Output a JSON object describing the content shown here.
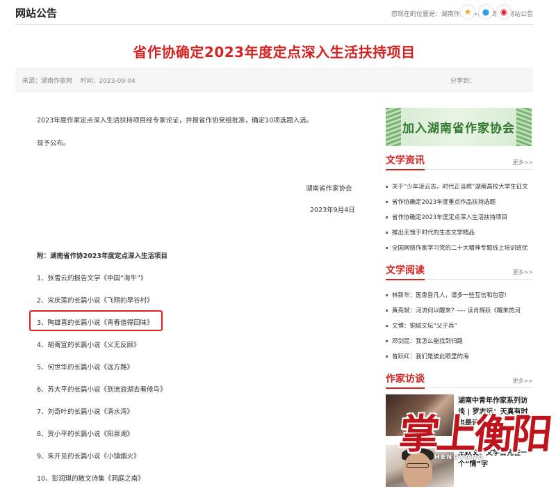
{
  "header": {
    "page_title": "网站公告",
    "breadcrumb": "您现在的位置是：湖南作家网>新闻资讯>网站公告"
  },
  "article": {
    "title": "省作协确定2023年度定点深入生活扶持项目",
    "meta": "来源：湖南作家网    时间：2023-09-04",
    "share_label": "分享到：",
    "share_icons": [
      "qzone-icon",
      "qq-icon",
      "weibo-icon"
    ],
    "paragraph_1": "2023年度作家定点深入生活扶持项目经专家论证，并报省作协党组批准，确定10项选题入选。",
    "paragraph_2": "现予公布。",
    "sign_org": "湖南省作家协会",
    "sign_date": "2023年9月4日",
    "annex_title": "附：湖南省作协2023年度定点深入生活项目",
    "items": [
      "1、张雪云的报告文学《中国“海牛”》",
      "2、宋庆莲的长篇小说《飞翔的早谷村》",
      "3、陶雄喜的长篇小说《青春值得回味》",
      "4、胡菁宣的长篇小说《义无反顾》",
      "5、何世华的长篇小说《远方路》",
      "6、苏大平的长篇小说《到流浪湖去看候鸟》",
      "7、刘奇叶的长篇小说《清水湾》",
      "8、贺小平的长篇小说《阳泉湖》",
      "9、朱开见的长篇小说《小镇烟火》",
      "10、彭润琪的散文诗集《洞庭之南》"
    ],
    "highlight_color": "#e02020"
  },
  "sidebar": {
    "banner_text": "加入湖南省作家协会",
    "more_label": "更多>>",
    "news": {
      "title": "文学资讯",
      "items": [
        "关于“少年凌云志，时代正当燃”湖南高校大学生征文",
        "省作协确定2023年度重点作品扶持选题",
        "省作协确定2023年度定点深入生活扶持项目",
        "推出无愧于时代的生态文学精品",
        "全国网络作家学习党的二十大精神专题线上培训班优"
      ]
    },
    "reading": {
      "title": "文学阅读",
      "items": [
        "林新华：医患皆凡人，请多一些互信和包容!",
        "黄亮斌：河流何以醒来？---- 读肖辉跃《醒来的河",
        "文博：铜城文坛“父子兵”",
        "邓剑昆：我怎么能找到归路",
        "曾跃红：我们是彼此眼里的海"
      ]
    },
    "interviews": {
      "title": "作家访谈",
      "items": [
        {
          "text": "湖南中青年作家系列访谈 | 罗志远：天真有时也是诗"
        },
        {
          "text": "王跃文：文学首先在一个“情”字"
        }
      ]
    }
  },
  "watermark": {
    "text": "掌上衡阳",
    "sub": "HENGYANG"
  },
  "colors": {
    "accent": "#d42322",
    "meta_bg": "#f5f5f5"
  }
}
